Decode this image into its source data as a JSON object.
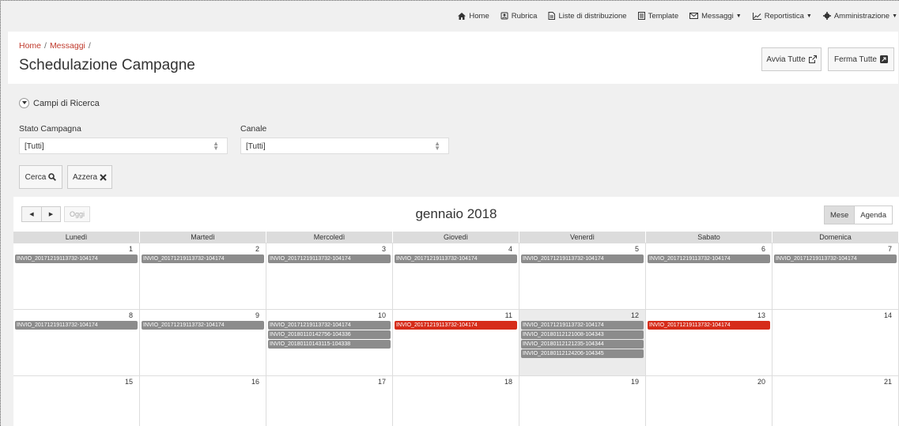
{
  "nav": {
    "home": "Home",
    "rubrica": "Rubrica",
    "liste": "Liste di distribuzione",
    "template": "Template",
    "messaggi": "Messaggi",
    "reportistica": "Reportistica",
    "amministrazione": "Amministrazione"
  },
  "breadcrumb": {
    "home": "Home",
    "messaggi": "Messaggi"
  },
  "page_title": "Schedulazione Campagne",
  "header_buttons": {
    "avvia": "Avvia Tutte",
    "ferma": "Ferma Tutte"
  },
  "search": {
    "toggle_label": "Campi di Ricerca",
    "stato_label": "Stato Campagna",
    "stato_value": "[Tutti]",
    "canale_label": "Canale",
    "canale_value": "[Tutti]",
    "cerca": "Cerca",
    "azzera": "Azzera"
  },
  "calendar": {
    "title": "gennaio 2018",
    "today": "Oggi",
    "view_mese": "Mese",
    "view_agenda": "Agenda",
    "weekdays": [
      "Lunedì",
      "Martedì",
      "Mercoledì",
      "Giovedì",
      "Venerdì",
      "Sabato",
      "Domenica"
    ],
    "weeks": [
      [
        {
          "day": "1",
          "events": [
            {
              "label": "INVIO_20171219113732-104174",
              "color": "grey"
            }
          ]
        },
        {
          "day": "2",
          "events": [
            {
              "label": "INVIO_20171219113732-104174",
              "color": "grey"
            }
          ]
        },
        {
          "day": "3",
          "events": [
            {
              "label": "INVIO_20171219113732-104174",
              "color": "grey"
            }
          ]
        },
        {
          "day": "4",
          "events": [
            {
              "label": "INVIO_20171219113732-104174",
              "color": "grey"
            }
          ]
        },
        {
          "day": "5",
          "events": [
            {
              "label": "INVIO_20171219113732-104174",
              "color": "grey"
            }
          ]
        },
        {
          "day": "6",
          "events": [
            {
              "label": "INVIO_20171219113732-104174",
              "color": "grey"
            }
          ]
        },
        {
          "day": "7",
          "events": [
            {
              "label": "INVIO_20171219113732-104174",
              "color": "grey"
            }
          ]
        }
      ],
      [
        {
          "day": "8",
          "events": [
            {
              "label": "INVIO_20171219113732-104174",
              "color": "grey"
            }
          ]
        },
        {
          "day": "9",
          "events": [
            {
              "label": "INVIO_20171219113732-104174",
              "color": "grey"
            }
          ]
        },
        {
          "day": "10",
          "events": [
            {
              "label": "INVIO_20171219113732-104174",
              "color": "grey"
            },
            {
              "label": "INVIO_20180110142756-104336",
              "color": "grey"
            },
            {
              "label": "INVIO_20180110143115-104338",
              "color": "grey"
            }
          ]
        },
        {
          "day": "11",
          "events": [
            {
              "label": "INVIO_20171219113732-104174",
              "color": "red"
            }
          ]
        },
        {
          "day": "12",
          "highlight": true,
          "events": [
            {
              "label": "INVIO_20171219113732-104174",
              "color": "grey"
            },
            {
              "label": "INVIO_20180112121008-104343",
              "color": "grey"
            },
            {
              "label": "INVIO_20180112121235-104344",
              "color": "grey"
            },
            {
              "label": "INVIO_20180112124206-104345",
              "color": "grey"
            }
          ]
        },
        {
          "day": "13",
          "events": [
            {
              "label": "INVIO_20171219113732-104174",
              "color": "red"
            }
          ]
        },
        {
          "day": "14",
          "events": []
        }
      ],
      [
        {
          "day": "15",
          "events": []
        },
        {
          "day": "16",
          "events": []
        },
        {
          "day": "17",
          "events": []
        },
        {
          "day": "18",
          "events": []
        },
        {
          "day": "19",
          "events": []
        },
        {
          "day": "20",
          "events": []
        },
        {
          "day": "21",
          "events": []
        }
      ]
    ]
  },
  "colors": {
    "accent": "#c0392b",
    "event_grey": "#8c8c8c",
    "event_red": "#d62c1a"
  }
}
